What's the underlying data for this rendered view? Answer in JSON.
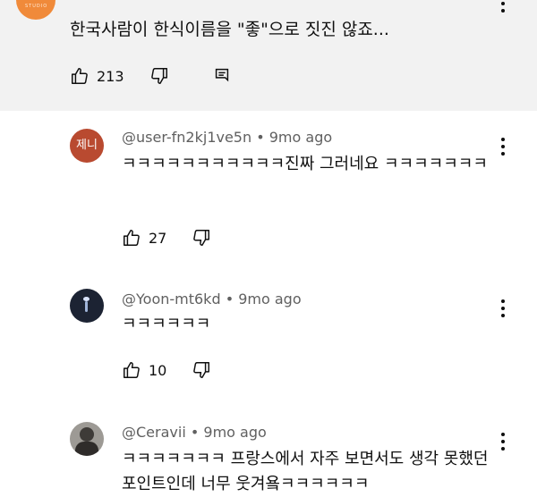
{
  "parent_comment": {
    "text": "한국사람이 한식이름을 \"좋\"으로 짓진 않죠...",
    "like_count": "213",
    "avatar_caption": "STUDIO"
  },
  "replies": [
    {
      "author": "@user-fn2kj1ve5n",
      "time": "9mo ago",
      "avatar_text": "제니",
      "text": "ㅋㅋㅋㅋㅋㅋㅋㅋㅋㅋㅋ진짜 그러네요 ㅋㅋㅋㅋㅋㅋㅋ",
      "like_count": "27"
    },
    {
      "author": "@Yoon-mt6kd",
      "time": "9mo ago",
      "text": "ㅋㅋㅋㅋㅋㅋ",
      "like_count": "10"
    },
    {
      "author": "@Ceravii",
      "time": "9mo ago",
      "text": "ㅋㅋㅋㅋㅋㅋㅋ 프랑스에서 자주 보면서도 생각 못했던 포인트인데 너무 웃겨욬ㅋㅋㅋㅋㅋㅋ"
    }
  ],
  "separator": "•"
}
